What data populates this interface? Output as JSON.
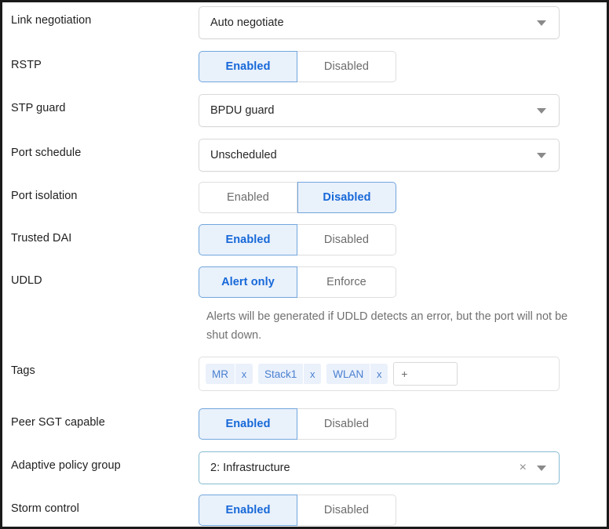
{
  "form": {
    "rows": [
      {
        "label": "Link negotiation",
        "type": "select",
        "value": "Auto negotiate",
        "name": "link-negotiation"
      },
      {
        "label": "RSTP",
        "type": "toggle",
        "options": [
          "Enabled",
          "Disabled"
        ],
        "selected": 0,
        "name": "rstp"
      },
      {
        "label": "STP guard",
        "type": "select",
        "value": "BPDU guard",
        "name": "stp-guard"
      },
      {
        "label": "Port schedule",
        "type": "select",
        "value": "Unscheduled",
        "name": "port-schedule"
      },
      {
        "label": "Port isolation",
        "type": "toggle",
        "options": [
          "Enabled",
          "Disabled"
        ],
        "selected": 1,
        "name": "port-isolation"
      },
      {
        "label": "Trusted DAI",
        "type": "toggle",
        "options": [
          "Enabled",
          "Disabled"
        ],
        "selected": 0,
        "name": "trusted-dai"
      },
      {
        "label": "UDLD",
        "type": "toggle",
        "options": [
          "Alert only",
          "Enforce"
        ],
        "selected": 0,
        "name": "udld",
        "helper": "Alerts will be generated if UDLD detects an error, but the port will not be\nshut down."
      },
      {
        "label": "Tags",
        "type": "tags",
        "tags": [
          "MR",
          "Stack1",
          "WLAN"
        ],
        "remove_label": "x",
        "add_label": "+",
        "name": "tags"
      },
      {
        "label": "Peer SGT capable",
        "type": "toggle",
        "options": [
          "Enabled",
          "Disabled"
        ],
        "selected": 0,
        "name": "peer-sgt-capable"
      },
      {
        "label": "Adaptive policy group",
        "type": "select-clearable",
        "value": "2: Infrastructure",
        "clear_label": "×",
        "name": "adaptive-policy-group"
      },
      {
        "label": "Storm control",
        "type": "toggle",
        "options": [
          "Enabled",
          "Disabled"
        ],
        "selected": 0,
        "name": "storm-control"
      }
    ]
  },
  "colors": {
    "accent_blue": "#1668d8",
    "toggle_on_bg": "#e9f1fb",
    "toggle_on_border": "#72a6dd",
    "tag_bg": "#eaf1fb",
    "tag_text": "#4a7fd0",
    "teal_border": "#86bcd0",
    "label_text": "#1f1f1f",
    "helper_text": "#707070"
  }
}
